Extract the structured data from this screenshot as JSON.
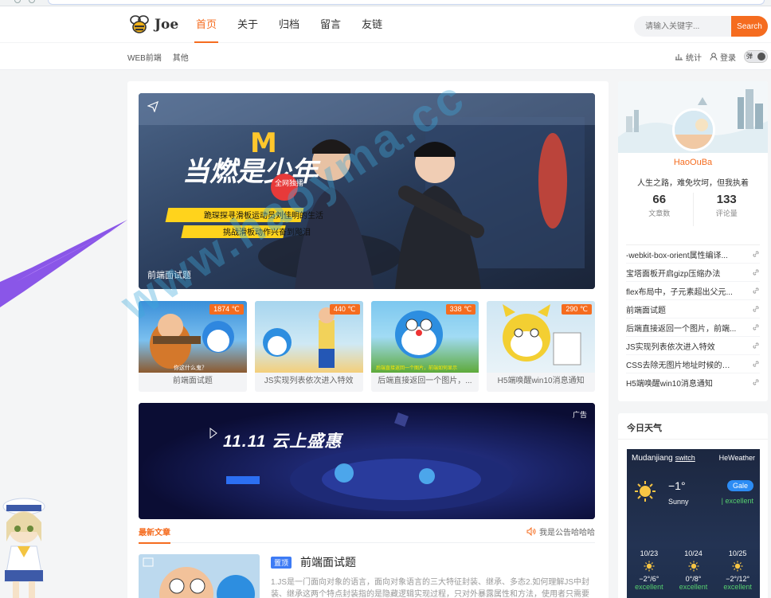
{
  "header": {
    "logo_text": "Joe",
    "nav": [
      {
        "label": "首页",
        "active": true
      },
      {
        "label": "关于",
        "active": false
      },
      {
        "label": "归档",
        "active": false
      },
      {
        "label": "留言",
        "active": false
      },
      {
        "label": "友链",
        "active": false
      }
    ],
    "search_placeholder": "请输入关键字...",
    "search_button": "Search",
    "subnav": [
      "WEB前端",
      "其他"
    ],
    "stats_label": "统计",
    "login_label": "登录",
    "toggle_label": "弹",
    "accent_color": "#f56c1f"
  },
  "hero": {
    "caption": "前端面试题",
    "poster_title": "当燃是少年",
    "poster_tag": "全网独播",
    "poster_line1": "跪琛探寻滑板运动员刘佳明的生活",
    "poster_line2": "挑战滑板动作兴奋到飚泪"
  },
  "cards": [
    {
      "heat": "1874 ℃",
      "title": "前端面试题",
      "overlay": "你这什么鬼？"
    },
    {
      "heat": "440 ℃",
      "title": "JS实现列表依次进入特效",
      "overlay": ""
    },
    {
      "heat": "338 ℃",
      "title": "后端直接返回一个图片，...",
      "overlay": "后端直接返回一个图片，前端如何显示"
    },
    {
      "heat": "290 ℃",
      "title": "H5端唤醒win10消息通知",
      "overlay": ""
    }
  ],
  "ad": {
    "tag": "广告",
    "headline": "11.11 云上盛惠"
  },
  "feed": {
    "tab_latest": "最新文章",
    "notice": "我是公告哈哈哈"
  },
  "article": {
    "badge": "置顶",
    "title": "前端面试题",
    "excerpt": "1.JS是一门面向对象的语言，面向对象语言的三大特征封装、继承、多态2.如何理解JS中封装、继承这两个特点封装指的是隐藏逻辑实现过程，只对外暴露属性和方法，使用者只需要"
  },
  "profile": {
    "username": "HaoOuBa",
    "motto": "人生之路，难免坎坷，但我执着",
    "stats": [
      {
        "num": "66",
        "label": "文章数"
      },
      {
        "num": "133",
        "label": "评论量"
      }
    ],
    "recent": [
      "-webkit-box-orient属性编译...",
      "宝塔面板开启gizp压缩办法",
      "flex布局中，子元素超出父元...",
      "前端面试题",
      "后端直接返回一个图片，前端...",
      "JS实现列表依次进入特效",
      "CSS去除无图片地址时候的边框",
      "H5端唤醒win10消息通知"
    ]
  },
  "weather": {
    "box_title": "今日天气",
    "city": "Mudanjiang",
    "switch_label": "switch",
    "brand": "HeWeather",
    "temp": "−1°",
    "condition": "Sunny",
    "aqi_badge": "Gale",
    "aqi": "| excellent",
    "forecast": [
      {
        "date": "10/23",
        "range": "−2°/6°",
        "quality": "excellent"
      },
      {
        "date": "10/24",
        "range": "0°/8°",
        "quality": "excellent"
      },
      {
        "date": "10/25",
        "range": "−2°/12°",
        "quality": "excellent"
      }
    ]
  },
  "watermark": "www.haoyma.cc"
}
